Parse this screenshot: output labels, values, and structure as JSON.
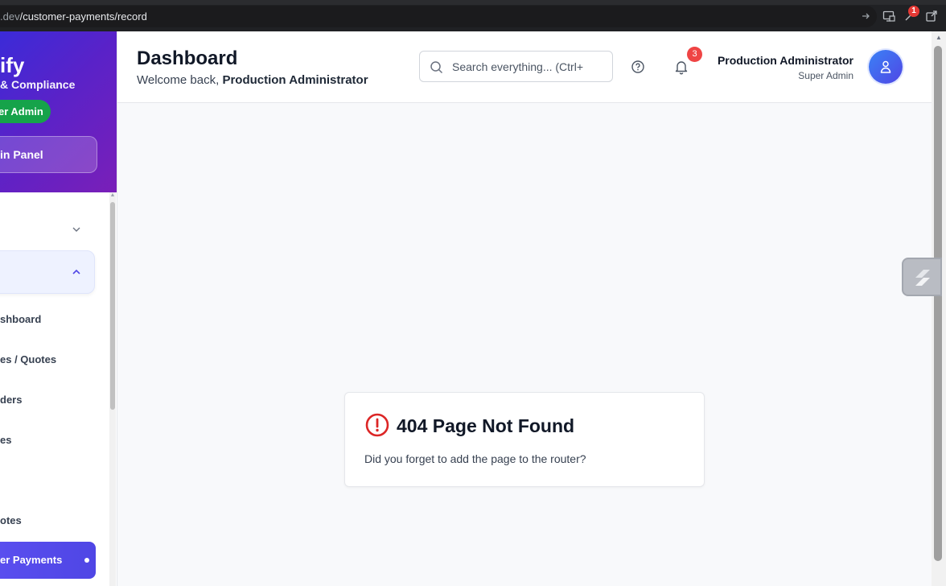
{
  "browser": {
    "url_domain_tail": ".dev",
    "url_path": "/customer-payments/record",
    "extension_badge": "1"
  },
  "sidebar": {
    "brand_name": "ify",
    "brand_subtitle": "& Compliance",
    "role_pill": "er Admin",
    "admin_panel_button": "in Panel",
    "items": [
      {
        "label": "shboard"
      },
      {
        "label": "es / Quotes"
      },
      {
        "label": "ders"
      },
      {
        "label": "es"
      },
      {
        "label": "otes"
      }
    ],
    "active_item": "er Payments"
  },
  "header": {
    "title": "Dashboard",
    "welcome_prefix": "Welcome back,",
    "welcome_user": "Production Administrator",
    "search_placeholder": "Search everything... (Ctrl+",
    "notification_count": "3",
    "user_name": "Production Administrator",
    "user_role": "Super Admin"
  },
  "main": {
    "error_title": "404 Page Not Found",
    "error_message": "Did you forget to add the page to the router?"
  },
  "colors": {
    "sidebar_gradient_start": "#3b2bd8",
    "sidebar_gradient_end": "#7a1fb8",
    "role_pill": "#16a34a",
    "active_nav": "#4f46e5",
    "notification_badge": "#ef4444",
    "error_icon": "#dc2626",
    "avatar": "#4f46e5"
  },
  "icons": [
    "search-icon",
    "help-icon",
    "bell-icon",
    "user-icon",
    "alert-circle-icon",
    "chevron-down-icon",
    "chevron-up-icon",
    "forward-icon",
    "cast-icon",
    "extension-icon",
    "open-external-icon",
    "widget-logo-icon"
  ]
}
